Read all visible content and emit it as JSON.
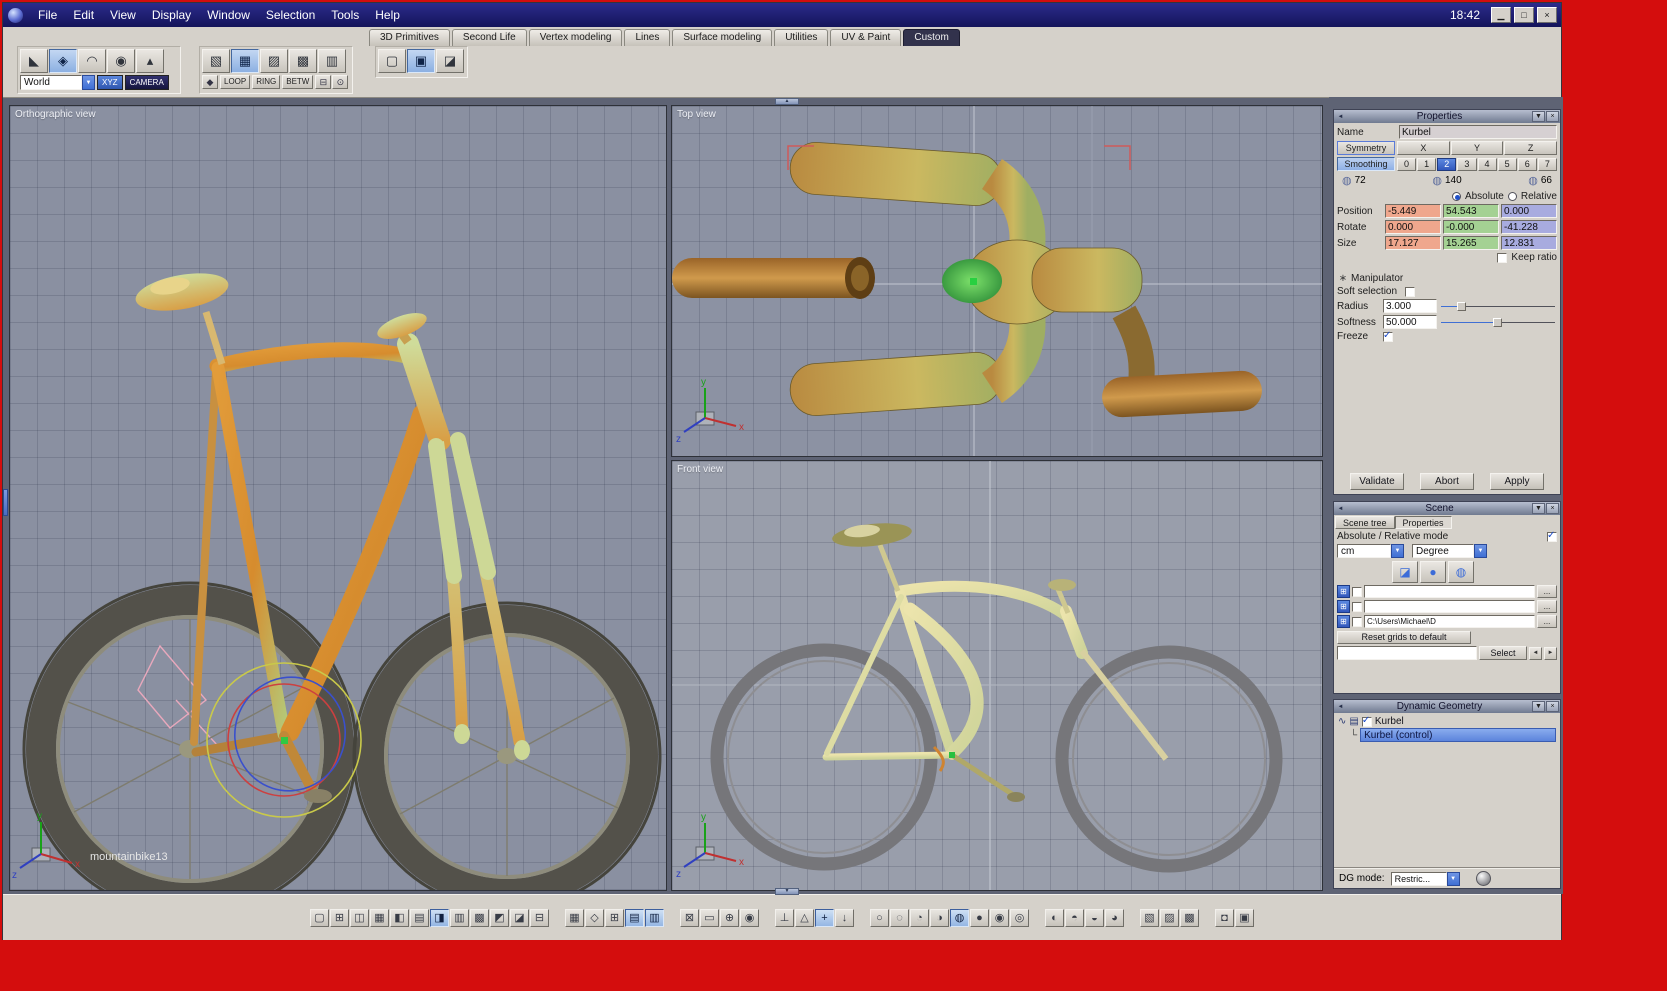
{
  "window": {
    "clock": "18:42",
    "menus": [
      {
        "name": "menu-file",
        "label": "File"
      },
      {
        "name": "menu-edit",
        "label": "Edit"
      },
      {
        "name": "menu-view",
        "label": "View"
      },
      {
        "name": "menu-display",
        "label": "Display"
      },
      {
        "name": "menu-window",
        "label": "Window"
      },
      {
        "name": "menu-selection",
        "label": "Selection"
      },
      {
        "name": "menu-tools",
        "label": "Tools"
      },
      {
        "name": "menu-help",
        "label": "Help"
      }
    ],
    "window_buttons": [
      {
        "name": "minimize-button",
        "glyph": "▁"
      },
      {
        "name": "maximize-button",
        "glyph": "□"
      },
      {
        "name": "close-button",
        "glyph": "×"
      }
    ]
  },
  "tabs": [
    {
      "name": "tab-3d-primitives",
      "label": "3D Primitives"
    },
    {
      "name": "tab-second-life",
      "label": "Second Life"
    },
    {
      "name": "tab-vertex-modeling",
      "label": "Vertex modeling"
    },
    {
      "name": "tab-lines",
      "label": "Lines"
    },
    {
      "name": "tab-surface-modeling",
      "label": "Surface modeling"
    },
    {
      "name": "tab-utilities",
      "label": "Utilities"
    },
    {
      "name": "tab-uv-paint",
      "label": "UV & Paint"
    },
    {
      "name": "tab-custom",
      "label": "Custom",
      "active": true
    }
  ],
  "toolbar": {
    "select_tools": [
      {
        "name": "scalpel-tool-icon",
        "glyph": "◣"
      },
      {
        "name": "hand-tool-icon",
        "glyph": "◈",
        "active": true
      },
      {
        "name": "arc-tool-icon",
        "glyph": "◠"
      },
      {
        "name": "sphere-brush-tool-icon",
        "glyph": "◉"
      },
      {
        "name": "pin-tool-icon",
        "glyph": "▴"
      }
    ],
    "world_value": "World",
    "xyz_label": "XYZ",
    "camera_label": "CAMERA",
    "cube_tools": [
      {
        "name": "point-mode-icon",
        "glyph": "▧"
      },
      {
        "name": "edge-mode-icon",
        "glyph": "▦",
        "active": true
      },
      {
        "name": "face-mode-icon",
        "glyph": "▨"
      },
      {
        "name": "object-mode-icon",
        "glyph": "▩"
      },
      {
        "name": "uv-mode-icon",
        "glyph": "▥"
      }
    ],
    "pre_mini": [
      {
        "name": "paint-select-icon",
        "glyph": "◆"
      }
    ],
    "loop_label": "LOOP",
    "ring_label": "RING",
    "betw_label": "BETW",
    "post_mini": [
      {
        "name": "shrink-selection-icon",
        "glyph": "⊟"
      },
      {
        "name": "grow-selection-icon",
        "glyph": "⊙"
      }
    ],
    "file_tools": [
      {
        "name": "copy-icon",
        "glyph": "▢"
      },
      {
        "name": "paste-icon",
        "glyph": "▣",
        "active": true
      },
      {
        "name": "eraser-icon",
        "glyph": "◪"
      }
    ]
  },
  "viewports": {
    "orthographic": {
      "label": "Orthographic view",
      "object_name": "mountainbike13"
    },
    "top": {
      "label": "Top view"
    },
    "front": {
      "label": "Front view"
    }
  },
  "axis_labels": {
    "x": "x",
    "y": "y",
    "z": "z"
  },
  "properties": {
    "title": "Properties",
    "name_label": "Name",
    "name_value": "Kurbel",
    "symmetry_label": "Symmetry",
    "axis_headers": [
      {
        "name": "x-axis-header",
        "label": "X"
      },
      {
        "name": "y-axis-header",
        "label": "Y"
      },
      {
        "name": "z-axis-header",
        "label": "Z"
      }
    ],
    "smoothing_label": "Smoothing",
    "smoothing_levels": [
      {
        "name": "smoothing-level-0",
        "label": "0"
      },
      {
        "name": "smoothing-level-1",
        "label": "1"
      },
      {
        "name": "smoothing-level-2",
        "label": "2",
        "active": true
      },
      {
        "name": "smoothing-level-3",
        "label": "3"
      },
      {
        "name": "smoothing-level-4",
        "label": "4"
      },
      {
        "name": "smoothing-level-5",
        "label": "5"
      },
      {
        "name": "smoothing-level-6",
        "label": "6"
      },
      {
        "name": "smoothing-level-7",
        "label": "7"
      }
    ],
    "poly_counts": [
      {
        "name": "vertex-count",
        "glyph": "◍",
        "value": "72"
      },
      {
        "name": "edge-count",
        "glyph": "◍",
        "value": "140"
      },
      {
        "name": "face-count",
        "glyph": "◍",
        "value": "66"
      }
    ],
    "absolute_label": "Absolute",
    "relative_label": "Relative",
    "position_label": "Position",
    "position": {
      "x": "-5.449",
      "y": "54.543",
      "z": "0.000"
    },
    "rotate_label": "Rotate",
    "rotate": {
      "x": "0.000",
      "y": "-0.000",
      "z": "-41.228"
    },
    "size_label": "Size",
    "size": {
      "x": "17.127",
      "y": "15.265",
      "z": "12.831"
    },
    "keep_ratio_label": "Keep ratio",
    "manipulator_glyph": "∗",
    "manipulator_label": "Manipulator",
    "soft_selection_label": "Soft selection",
    "radius_label": "Radius",
    "radius_value": "3.000",
    "softness_label": "Softness",
    "softness_value": "50.000",
    "freeze_label": "Freeze",
    "validate_label": "Validate",
    "abort_label": "Abort",
    "apply_label": "Apply"
  },
  "scene": {
    "title": "Scene",
    "tab_scene_tree": "Scene tree",
    "tab_properties": "Properties",
    "abs_rel_label": "Absolute / Relative mode",
    "unit_value": "cm",
    "angle_value": "Degree",
    "display_tools": [
      {
        "name": "eraser-icon",
        "glyph": "◪",
        "tone": "pink"
      },
      {
        "name": "shaded-sphere-icon",
        "glyph": "●",
        "tone": "blue"
      },
      {
        "name": "wire-sphere-icon",
        "glyph": "◍",
        "tone": "blue"
      }
    ],
    "chip_glyph": "⊞",
    "grid_rows": [
      {
        "name": "grid-config-row-1",
        "value": ""
      },
      {
        "name": "grid-config-row-2",
        "value": ""
      },
      {
        "name": "grid-config-row-3",
        "value": "C:\\Users\\Michael\\D"
      }
    ],
    "ellipsis_label": "...",
    "reset_label": "Reset grids to default",
    "select_label": "Select"
  },
  "dynamic_geometry": {
    "title": "Dynamic Geometry",
    "curve_glyph": "∿",
    "surface_glyph": "▤",
    "root_label": "Kurbel",
    "branch_glyph": "└",
    "selected_label": "Kurbel (control)",
    "dg_mode_label": "DG mode:",
    "dg_mode_value": "Restric..."
  },
  "panel_controls": {
    "collapse_glyph": "◄",
    "menu_glyph": "▼",
    "close_glyph": "×",
    "up_glyph": "▲",
    "down_glyph": "▼"
  },
  "bottom_toolbar": {
    "layout_icons": [
      {
        "name": "layout-icon-1",
        "glyph": "▢"
      },
      {
        "name": "layout-icon-2",
        "glyph": "⊞"
      },
      {
        "name": "layout-icon-3",
        "glyph": "◫"
      },
      {
        "name": "layout-icon-4",
        "glyph": "▦"
      },
      {
        "name": "layout-icon-5",
        "glyph": "◧"
      },
      {
        "name": "layout-icon-6",
        "glyph": "▤"
      },
      {
        "name": "layout-icon-7",
        "glyph": "◨",
        "active": true
      },
      {
        "name": "layout-icon-8",
        "glyph": "▥"
      },
      {
        "name": "layout-icon-9",
        "glyph": "▩"
      },
      {
        "name": "layout-icon-10",
        "glyph": "◩"
      },
      {
        "name": "layout-icon-11",
        "glyph": "◪"
      },
      {
        "name": "layout-icon-12",
        "glyph": "⊟"
      }
    ],
    "uv_icons": [
      {
        "name": "uv-editor-icon",
        "glyph": "▦"
      },
      {
        "name": "paint-icon",
        "glyph": "◇"
      },
      {
        "name": "grid-icon",
        "glyph": "⊞"
      },
      {
        "name": "table-view-icon",
        "glyph": "▤",
        "active": true
      },
      {
        "name": "spreadsheet-icon",
        "glyph": "▥",
        "active": true
      }
    ],
    "view_icons": [
      {
        "name": "deselect-icon",
        "glyph": "⊠"
      },
      {
        "name": "frame-selection-icon",
        "glyph": "▭"
      },
      {
        "name": "zoom-icon",
        "glyph": "⊕"
      },
      {
        "name": "visibility-icon",
        "glyph": "◉"
      }
    ],
    "snap_icons": [
      {
        "name": "snap-grid-icon",
        "glyph": "⊥"
      },
      {
        "name": "snap-vertex-icon",
        "glyph": "△"
      },
      {
        "name": "manipulator-toggle-icon",
        "glyph": "+",
        "active": true
      },
      {
        "name": "drop-to-ground-icon",
        "glyph": "↓"
      }
    ],
    "shading_icons": [
      {
        "name": "wireframe-shading-icon",
        "glyph": "○"
      },
      {
        "name": "hidden-line-shading-icon",
        "glyph": "◌"
      },
      {
        "name": "flat-shading-icon",
        "glyph": "◔"
      },
      {
        "name": "smooth-shading-icon",
        "glyph": "◑"
      },
      {
        "name": "textured-shading-icon",
        "glyph": "◍",
        "active": true
      },
      {
        "name": "material-shading-icon",
        "glyph": "●"
      },
      {
        "name": "gold-shading-icon",
        "glyph": "◉"
      },
      {
        "name": "transparent-shading-icon",
        "glyph": "◎"
      }
    ],
    "light_icons": [
      {
        "name": "light-front-icon",
        "glyph": "◐"
      },
      {
        "name": "light-top-icon",
        "glyph": "◓"
      },
      {
        "name": "light-back-icon",
        "glyph": "◒"
      },
      {
        "name": "light-soft-icon",
        "glyph": "◕"
      }
    ],
    "prim_icons": [
      {
        "name": "cube-display-icon",
        "glyph": "▧"
      },
      {
        "name": "cube-uv-icon",
        "glyph": "▨"
      },
      {
        "name": "cube-grid-icon",
        "glyph": "▩"
      }
    ],
    "camera_icons": [
      {
        "name": "render-icon",
        "glyph": "◘"
      },
      {
        "name": "camera-icon",
        "glyph": "▣"
      }
    ]
  }
}
